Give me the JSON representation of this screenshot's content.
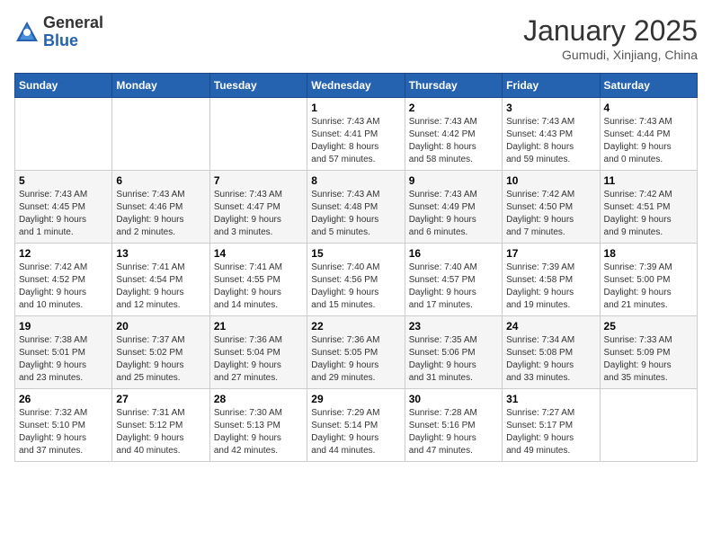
{
  "header": {
    "logo_general": "General",
    "logo_blue": "Blue",
    "month_title": "January 2025",
    "location": "Gumudi, Xinjiang, China"
  },
  "weekdays": [
    "Sunday",
    "Monday",
    "Tuesday",
    "Wednesday",
    "Thursday",
    "Friday",
    "Saturday"
  ],
  "weeks": [
    [
      {
        "day": "",
        "info": ""
      },
      {
        "day": "",
        "info": ""
      },
      {
        "day": "",
        "info": ""
      },
      {
        "day": "1",
        "info": "Sunrise: 7:43 AM\nSunset: 4:41 PM\nDaylight: 8 hours\nand 57 minutes."
      },
      {
        "day": "2",
        "info": "Sunrise: 7:43 AM\nSunset: 4:42 PM\nDaylight: 8 hours\nand 58 minutes."
      },
      {
        "day": "3",
        "info": "Sunrise: 7:43 AM\nSunset: 4:43 PM\nDaylight: 8 hours\nand 59 minutes."
      },
      {
        "day": "4",
        "info": "Sunrise: 7:43 AM\nSunset: 4:44 PM\nDaylight: 9 hours\nand 0 minutes."
      }
    ],
    [
      {
        "day": "5",
        "info": "Sunrise: 7:43 AM\nSunset: 4:45 PM\nDaylight: 9 hours\nand 1 minute."
      },
      {
        "day": "6",
        "info": "Sunrise: 7:43 AM\nSunset: 4:46 PM\nDaylight: 9 hours\nand 2 minutes."
      },
      {
        "day": "7",
        "info": "Sunrise: 7:43 AM\nSunset: 4:47 PM\nDaylight: 9 hours\nand 3 minutes."
      },
      {
        "day": "8",
        "info": "Sunrise: 7:43 AM\nSunset: 4:48 PM\nDaylight: 9 hours\nand 5 minutes."
      },
      {
        "day": "9",
        "info": "Sunrise: 7:43 AM\nSunset: 4:49 PM\nDaylight: 9 hours\nand 6 minutes."
      },
      {
        "day": "10",
        "info": "Sunrise: 7:42 AM\nSunset: 4:50 PM\nDaylight: 9 hours\nand 7 minutes."
      },
      {
        "day": "11",
        "info": "Sunrise: 7:42 AM\nSunset: 4:51 PM\nDaylight: 9 hours\nand 9 minutes."
      }
    ],
    [
      {
        "day": "12",
        "info": "Sunrise: 7:42 AM\nSunset: 4:52 PM\nDaylight: 9 hours\nand 10 minutes."
      },
      {
        "day": "13",
        "info": "Sunrise: 7:41 AM\nSunset: 4:54 PM\nDaylight: 9 hours\nand 12 minutes."
      },
      {
        "day": "14",
        "info": "Sunrise: 7:41 AM\nSunset: 4:55 PM\nDaylight: 9 hours\nand 14 minutes."
      },
      {
        "day": "15",
        "info": "Sunrise: 7:40 AM\nSunset: 4:56 PM\nDaylight: 9 hours\nand 15 minutes."
      },
      {
        "day": "16",
        "info": "Sunrise: 7:40 AM\nSunset: 4:57 PM\nDaylight: 9 hours\nand 17 minutes."
      },
      {
        "day": "17",
        "info": "Sunrise: 7:39 AM\nSunset: 4:58 PM\nDaylight: 9 hours\nand 19 minutes."
      },
      {
        "day": "18",
        "info": "Sunrise: 7:39 AM\nSunset: 5:00 PM\nDaylight: 9 hours\nand 21 minutes."
      }
    ],
    [
      {
        "day": "19",
        "info": "Sunrise: 7:38 AM\nSunset: 5:01 PM\nDaylight: 9 hours\nand 23 minutes."
      },
      {
        "day": "20",
        "info": "Sunrise: 7:37 AM\nSunset: 5:02 PM\nDaylight: 9 hours\nand 25 minutes."
      },
      {
        "day": "21",
        "info": "Sunrise: 7:36 AM\nSunset: 5:04 PM\nDaylight: 9 hours\nand 27 minutes."
      },
      {
        "day": "22",
        "info": "Sunrise: 7:36 AM\nSunset: 5:05 PM\nDaylight: 9 hours\nand 29 minutes."
      },
      {
        "day": "23",
        "info": "Sunrise: 7:35 AM\nSunset: 5:06 PM\nDaylight: 9 hours\nand 31 minutes."
      },
      {
        "day": "24",
        "info": "Sunrise: 7:34 AM\nSunset: 5:08 PM\nDaylight: 9 hours\nand 33 minutes."
      },
      {
        "day": "25",
        "info": "Sunrise: 7:33 AM\nSunset: 5:09 PM\nDaylight: 9 hours\nand 35 minutes."
      }
    ],
    [
      {
        "day": "26",
        "info": "Sunrise: 7:32 AM\nSunset: 5:10 PM\nDaylight: 9 hours\nand 37 minutes."
      },
      {
        "day": "27",
        "info": "Sunrise: 7:31 AM\nSunset: 5:12 PM\nDaylight: 9 hours\nand 40 minutes."
      },
      {
        "day": "28",
        "info": "Sunrise: 7:30 AM\nSunset: 5:13 PM\nDaylight: 9 hours\nand 42 minutes."
      },
      {
        "day": "29",
        "info": "Sunrise: 7:29 AM\nSunset: 5:14 PM\nDaylight: 9 hours\nand 44 minutes."
      },
      {
        "day": "30",
        "info": "Sunrise: 7:28 AM\nSunset: 5:16 PM\nDaylight: 9 hours\nand 47 minutes."
      },
      {
        "day": "31",
        "info": "Sunrise: 7:27 AM\nSunset: 5:17 PM\nDaylight: 9 hours\nand 49 minutes."
      },
      {
        "day": "",
        "info": ""
      }
    ]
  ]
}
